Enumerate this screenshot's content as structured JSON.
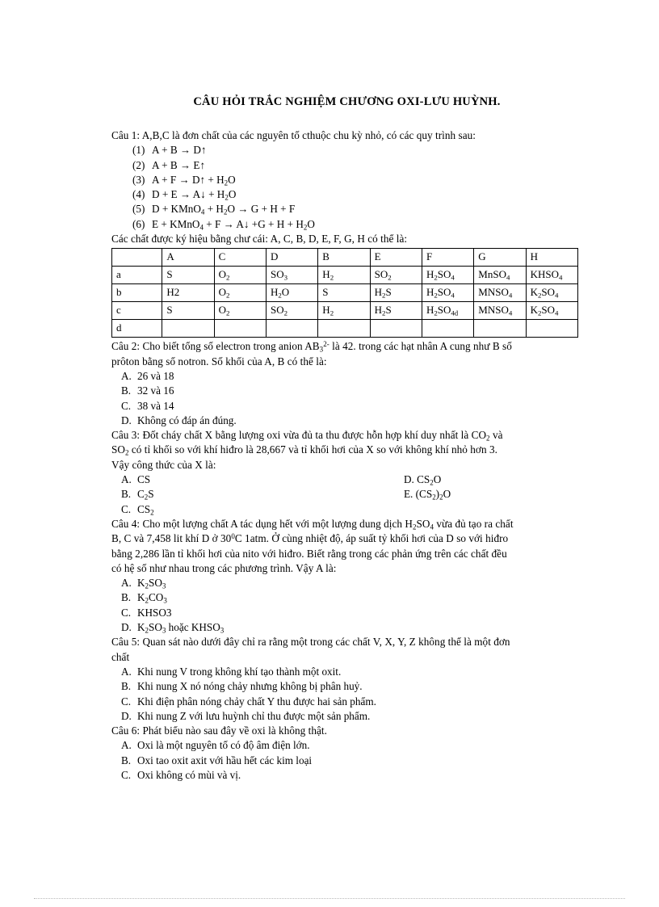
{
  "document": {
    "title": "CÂU HỎI TRẮC NGHIỆM CHƯƠNG OXI-LƯU HUỲNH."
  },
  "q1": {
    "stem": "Câu 1: A,B,C là đơn chất của các nguyên tố cthuộc chu kỳ nhỏ, có các quy trình sau:",
    "equations": [
      {
        "num": "(1)",
        "text": "A + B → D↑"
      },
      {
        "num": "(2)",
        "text": "A + B → E↑"
      },
      {
        "num": "(3)",
        "text": "A + F → D↑ + H2O"
      },
      {
        "num": "(4)",
        "text": "D + E → A↓ + H2O"
      },
      {
        "num": "(5)",
        "text": "D + KMnO4 + H2O → G + H + F"
      },
      {
        "num": "(6)",
        "text": "E + KMnO4 + F → A↓ +G + H + H2O"
      }
    ],
    "table_intro": "Các chất được ký hiệu bằng chư cái: A, C, B, D, E, F, G, H có thể là:",
    "table": {
      "headers": [
        "",
        "A",
        "C",
        "D",
        "B",
        "E",
        "F",
        "G",
        "H"
      ],
      "rows": [
        {
          "label": "a",
          "cells": [
            "S",
            "O2",
            "SO3",
            "H2",
            "SO2",
            "H2SO4",
            "MnSO4",
            "KHSO4"
          ]
        },
        {
          "label": "b",
          "cells": [
            "H2",
            "O2",
            "H2O",
            "S",
            "H2S",
            "H2SO4",
            "MNSO4",
            "K2SO4"
          ]
        },
        {
          "label": "c",
          "cells": [
            "S",
            "O2",
            "SO2",
            "H2",
            "H2S",
            "H2SO4d",
            "MNSO4",
            "K2SO4"
          ]
        },
        {
          "label": "d",
          "cells": [
            "",
            "",
            "",
            "",
            "",
            "",
            "",
            ""
          ]
        }
      ]
    }
  },
  "q2": {
    "stem_line1": "Câu 2: Cho biết tổng số electron trong anion AB32- là 42. trong các hạt nhân A cung như B số",
    "stem_line2": "prôton bằng số notron. Số khối của A, B có thể là:",
    "options": [
      {
        "letter": "A.",
        "text": "26 và 18"
      },
      {
        "letter": "B.",
        "text": "32 và 16"
      },
      {
        "letter": "C.",
        "text": "38 và 14"
      },
      {
        "letter": "D.",
        "text": "Không có đáp án đúng."
      }
    ]
  },
  "q3": {
    "stem_line1": "Câu 3: Đốt cháy chất X bằng lượng oxi vừa đủ ta thu được hỗn hợp khí duy nhất là CO2 và",
    "stem_line2": "SO2 có tỉ khối so với khí hiđro là 28,667 và tỉ khối hơi của X so với không khí nhỏ hơn 3.",
    "stem_line3": "Vậy công thức của X là:",
    "options_left": [
      {
        "letter": "A.",
        "text": "CS"
      },
      {
        "letter": "B.",
        "text": "C2S"
      },
      {
        "letter": "C.",
        "text": "CS2"
      }
    ],
    "options_right": [
      {
        "letter": "D.",
        "text": "CS2O"
      },
      {
        "letter": "E.",
        "text": "(CS2)2O"
      }
    ]
  },
  "q4": {
    "stem_line1": "Câu 4: Cho một lượng chất A tác dụng hết với một lượng dung dịch H2SO4 vừa đủ tạo ra chất",
    "stem_line2": "B, C và 7,458 lit khí D ở 300C 1atm. Ở cùng nhiệt độ, áp suất tỷ khối hơi của D so với hiđro",
    "stem_line3": "bằng 2,286 lần tỉ khối hơi của nito với hiđro. Biết rằng trong các phản ứng trên các chất đều",
    "stem_line4": "có hệ số như nhau trong các phương trình. Vậy A là:",
    "options": [
      {
        "letter": "A.",
        "text": "K2SO3"
      },
      {
        "letter": "B.",
        "text": "K2CO3"
      },
      {
        "letter": "C.",
        "text": "KHSO3"
      },
      {
        "letter": "D.",
        "text": "K2SO3 hoặc KHSO3"
      }
    ]
  },
  "q5": {
    "stem_line1": "Câu 5: Quan sát nào dưới đây chỉ ra rằng một trong các chất V, X, Y, Z không thể là một đơn",
    "stem_line2": "chất",
    "options": [
      {
        "letter": "A.",
        "text": "Khi nung V trong không khí tạo thành một oxit."
      },
      {
        "letter": "B.",
        "text": "Khi nung X nó nóng chảy nhưng không bị phân huỷ."
      },
      {
        "letter": "C.",
        "text": "Khi điện phân nóng chảy chất Y thu được hai sản phẩm."
      },
      {
        "letter": "D.",
        "text": "Khi nung Z với lưu huỳnh chỉ thu được một sản phẩm."
      }
    ]
  },
  "q6": {
    "stem": "Câu 6: Phát biểu nào sau đây về oxi là không thật.",
    "options": [
      {
        "letter": "A.",
        "text": "Oxi là một nguyên tố có độ âm điện lớn."
      },
      {
        "letter": "B.",
        "text": "Oxi tao oxit axit với hầu hết các kim loại"
      },
      {
        "letter": "C.",
        "text": "Oxi không có mùi và vị."
      }
    ]
  }
}
